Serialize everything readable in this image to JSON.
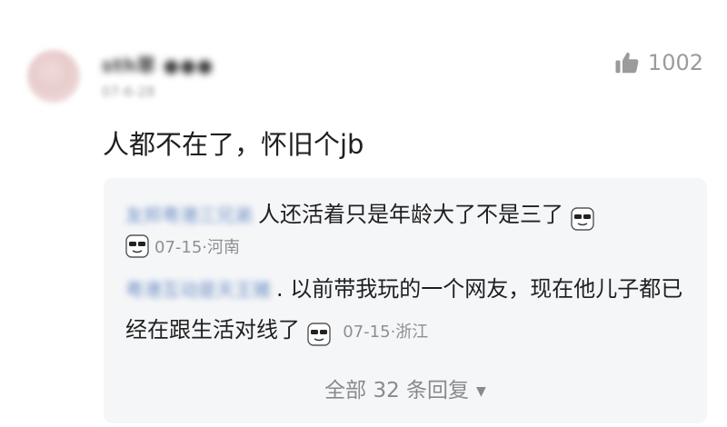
{
  "comment": {
    "username": "sth翠 ●●●",
    "time": "07-6-28",
    "likes": "1002",
    "text": "人都不在了，怀旧个jb"
  },
  "replies": [
    {
      "author": "友邦粤港三兄弟",
      "text": "人还活着只是年龄大了不是三了",
      "meta": "07-15·河南"
    },
    {
      "author": "粤港互动是天王猪",
      "text": ". 以前带我玩的一个网友，现在他儿子都已经在跟生活对线了",
      "meta": "07-15·浙江"
    }
  ],
  "expand": {
    "label": "全部 32 条回复"
  },
  "icons": {
    "like": "thumbs-up-icon",
    "sticker": "sunglasses-emoji-icon",
    "chevron": "chevron-down-icon"
  },
  "colors": {
    "reply_bg": "#f5f6f8",
    "meta_text": "#8f8f8f",
    "author_link": "#6e8fc4"
  }
}
